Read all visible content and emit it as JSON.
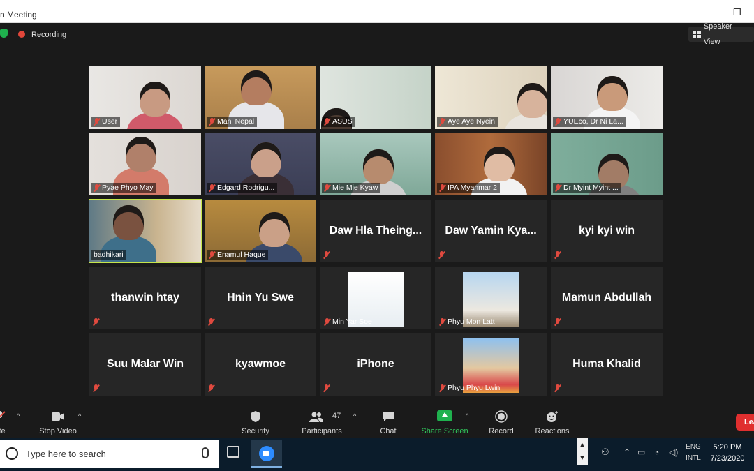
{
  "window": {
    "title": "n Meeting",
    "minimize_glyph": "—",
    "restore_glyph": "❐"
  },
  "meeting": {
    "recording_label": "Recording",
    "speaker_view_label": "Speaker View"
  },
  "participants": [
    {
      "name": "User",
      "video": true
    },
    {
      "name": "Mani Nepal",
      "video": true
    },
    {
      "name": "ASUS",
      "video": true
    },
    {
      "name": "Aye Aye  Nyein",
      "video": true
    },
    {
      "name": "YUEco, Dr Ni La...",
      "video": true
    },
    {
      "name": "Pyae Phyo May",
      "video": true
    },
    {
      "name": "Edgard Rodrigu...",
      "video": true
    },
    {
      "name": "Mie Mie Kyaw",
      "video": true
    },
    {
      "name": "IPA Myanmar 2",
      "video": true
    },
    {
      "name": "Dr Myint Myint ...",
      "video": true
    },
    {
      "name": "badhikari",
      "video": true,
      "active_speaker": true
    },
    {
      "name": "Enamul Haque",
      "video": true
    },
    {
      "name": "Daw  Hla  Theing...",
      "video": false
    },
    {
      "name": "Daw  Yamin  Kya...",
      "video": false
    },
    {
      "name": "kyi kyi win",
      "video": false
    },
    {
      "name": "thanwin htay",
      "video": false
    },
    {
      "name": "Hnin Yu Swe",
      "video": false
    },
    {
      "name": "Min Yar Soe",
      "video": false,
      "avatar": true
    },
    {
      "name": "Phyu Mon Latt",
      "video": false,
      "avatar": true
    },
    {
      "name": "Mamun Abdullah",
      "video": false
    },
    {
      "name": "Suu Malar Win",
      "video": false
    },
    {
      "name": "kyawmoe",
      "video": false
    },
    {
      "name": "iPhone",
      "video": false
    },
    {
      "name": "Phyu Phyu Lwin",
      "video": false,
      "avatar": true
    },
    {
      "name": "Huma Khalid",
      "video": false
    }
  ],
  "toolbar": {
    "mute_label": "ute",
    "stop_video_label": "Stop Video",
    "security_label": "Security",
    "participants_label": "Participants",
    "participants_count": "47",
    "chat_label": "Chat",
    "share_screen_label": "Share Screen",
    "record_label": "Record",
    "reactions_label": "Reactions",
    "leave_label": "Lea",
    "caret": "^"
  },
  "taskbar": {
    "search_placeholder": "Type here to search",
    "language_line1": "ENG",
    "language_line2": "INTL",
    "time": "5:20 PM",
    "date": "7/23/2020"
  },
  "colors": {
    "zoom_bg": "#1a1a1a",
    "tile_bg": "#262626",
    "active_speaker_border": "#c6e64b",
    "muted_red": "#e04a3f",
    "share_green": "#1fb14e",
    "leave_red": "#e02f2f",
    "taskbar": "#0b1c2b"
  }
}
